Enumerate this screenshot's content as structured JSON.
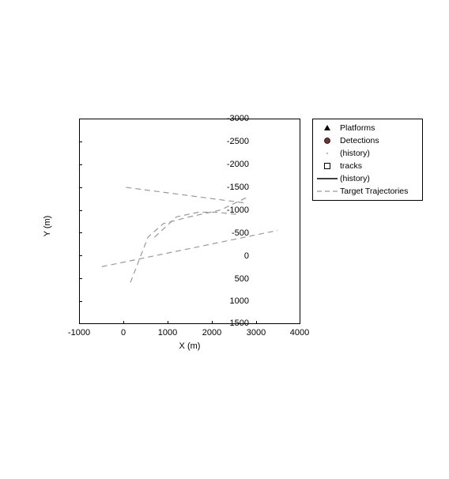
{
  "chart_data": {
    "type": "line",
    "title": "",
    "xlabel": "X (m)",
    "ylabel": "Y (m)",
    "xlim": [
      -1000,
      4000
    ],
    "ylim": [
      -3000,
      1500
    ],
    "y_direction": "reverse",
    "x_ticks": [
      -1000,
      0,
      1000,
      2000,
      3000,
      4000
    ],
    "y_ticks": [
      -3000,
      -2500,
      -2000,
      -1500,
      -1000,
      -500,
      0,
      500,
      1000,
      1500
    ],
    "series": [
      {
        "name": "Target Trajectories",
        "type": "dashed",
        "color": "#999999",
        "segments": [
          {
            "x": [
              -500,
              3500
            ],
            "y": [
              250,
              -550
            ]
          },
          {
            "x": [
              50,
              2800
            ],
            "y": [
              -1500,
              -1150
            ]
          },
          {
            "x": [
              150,
              550,
              900,
              1500,
              2200,
              2850
            ],
            "y": [
              600,
              -400,
              -700,
              -850,
              -1000,
              -1300
            ]
          },
          {
            "x": [
              700,
              1200,
              1700,
              2100,
              2600
            ],
            "y": [
              -400,
              -850,
              -950,
              -950,
              -900
            ]
          }
        ]
      }
    ],
    "legend": [
      {
        "label": "Platforms",
        "marker": "triangle",
        "color": "#000000"
      },
      {
        "label": "Detections",
        "marker": "circle-filled",
        "color": "#7a2e2e"
      },
      {
        "label": "(history)",
        "marker": "dot",
        "color": "#bbbbbb"
      },
      {
        "label": "tracks",
        "marker": "square",
        "color": "#000000"
      },
      {
        "label": "(history)",
        "marker": "solid-line",
        "color": "#000000"
      },
      {
        "label": "Target Trajectories",
        "marker": "dashed-line",
        "color": "#999999"
      }
    ]
  }
}
